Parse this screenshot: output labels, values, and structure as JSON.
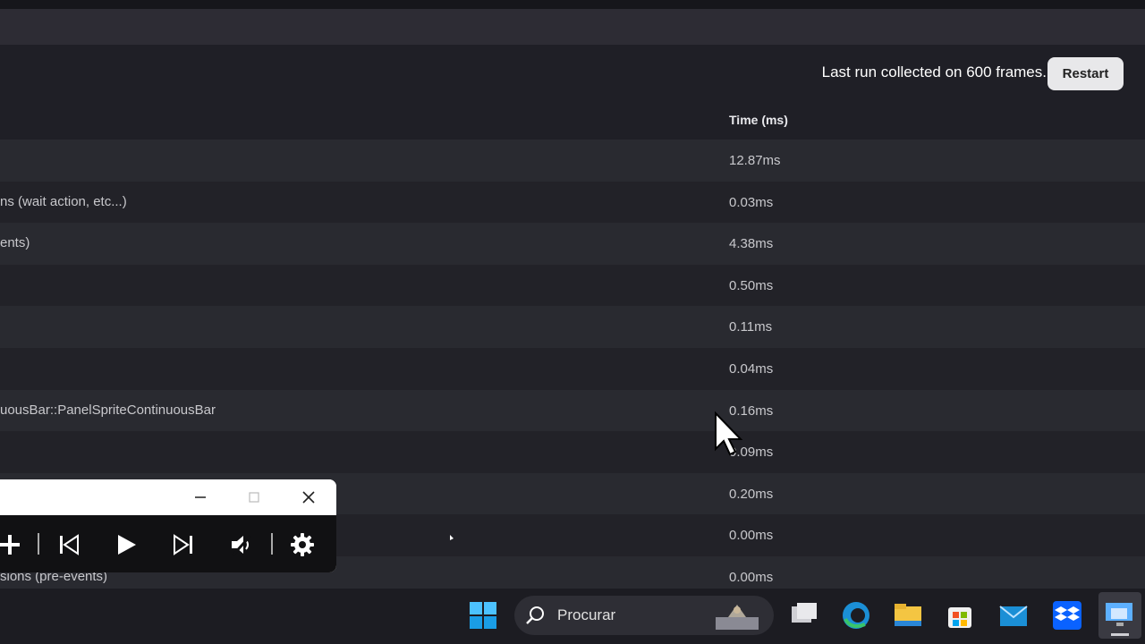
{
  "header": {
    "run_info": "Last run collected on 600 frames.",
    "restart_label": "Restart"
  },
  "table": {
    "time_header": "Time (ms)",
    "rows": [
      {
        "name": "",
        "time": "12.87ms"
      },
      {
        "name": "ns (wait action, etc...)",
        "time": "0.03ms"
      },
      {
        "name": "ents)",
        "time": "4.38ms"
      },
      {
        "name": "",
        "time": "0.50ms"
      },
      {
        "name": "",
        "time": "0.11ms"
      },
      {
        "name": "",
        "time": "0.04ms"
      },
      {
        "name": "uousBar::PanelSpriteContinuousBar",
        "time": "0.16ms"
      },
      {
        "name": "",
        "time": "0.09ms"
      },
      {
        "name": "",
        "time": "0.20ms"
      },
      {
        "name": "",
        "time": "0.00ms"
      },
      {
        "name": "sions (pre-events)",
        "time": "0.00ms"
      }
    ]
  },
  "player": {
    "icons": [
      "plus-icon",
      "skip-back-icon",
      "play-icon",
      "skip-forward-icon",
      "volume-icon",
      "settings-icon"
    ],
    "window_icons": [
      "minimize-icon",
      "maximize-icon",
      "close-icon"
    ]
  },
  "taskbar": {
    "search_placeholder": "Procurar",
    "icons": [
      "windows-start-icon",
      "search-icon",
      "task-view-icon",
      "edge-icon",
      "file-explorer-icon",
      "store-icon",
      "mail-icon",
      "dropbox-icon",
      "remote-desktop-icon"
    ],
    "accent_color": "#0a7fd6"
  }
}
